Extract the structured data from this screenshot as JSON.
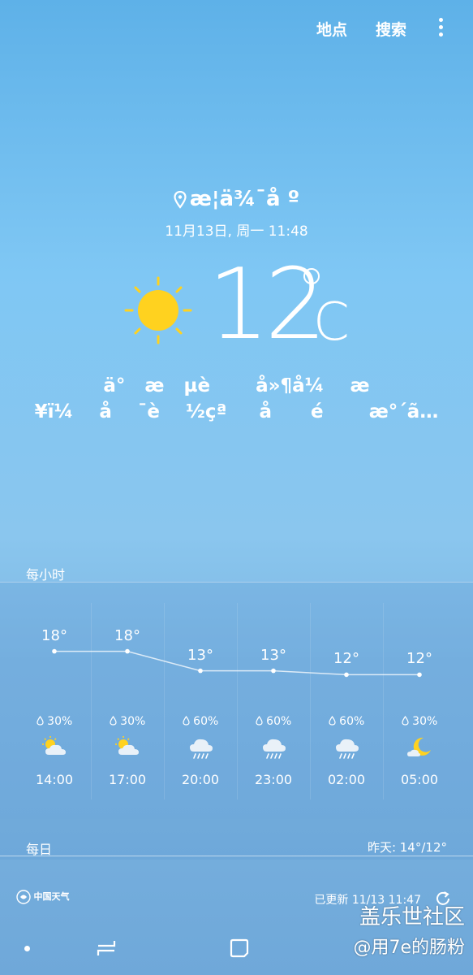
{
  "top_bar": {
    "location_label": "地点",
    "search_label": "搜索",
    "more_icon": "more-vert-icon"
  },
  "header": {
    "location": "æ¦ä¾¯å  º",
    "date": "11月13日, 周一 11:48",
    "temperature": "12",
    "unit": "C",
    "weather_icon": "sun-icon",
    "desc_line1": "ä°   æ   µè       å»¶å¼    æ",
    "desc_line2": "¥ï¼    å    ¯è    ½çª     å      é       æ°´ã…"
  },
  "hourly": {
    "label": "每小时",
    "items": [
      {
        "temp": "18°",
        "rain": "30%",
        "icon": "partly-cloudy-day-icon",
        "time": "14:00",
        "value": 18
      },
      {
        "temp": "18°",
        "rain": "30%",
        "icon": "partly-cloudy-day-icon",
        "time": "17:00",
        "value": 18
      },
      {
        "temp": "13°",
        "rain": "60%",
        "icon": "rain-cloud-icon",
        "time": "20:00",
        "value": 13
      },
      {
        "temp": "13°",
        "rain": "60%",
        "icon": "rain-cloud-icon",
        "time": "23:00",
        "value": 13
      },
      {
        "temp": "12°",
        "rain": "60%",
        "icon": "rain-cloud-icon",
        "time": "02:00",
        "value": 12
      },
      {
        "temp": "12°",
        "rain": "30%",
        "icon": "moon-cloud-icon",
        "time": "05:00",
        "value": 12
      }
    ]
  },
  "daily": {
    "label": "每日",
    "yesterday": "昨天: 14°/12°"
  },
  "footer": {
    "logo_text": "中国天气",
    "updated": "已更新 11/13 11:47"
  },
  "watermark": {
    "line1": "盖乐世社区",
    "line2": "@用7e的肠粉"
  }
}
